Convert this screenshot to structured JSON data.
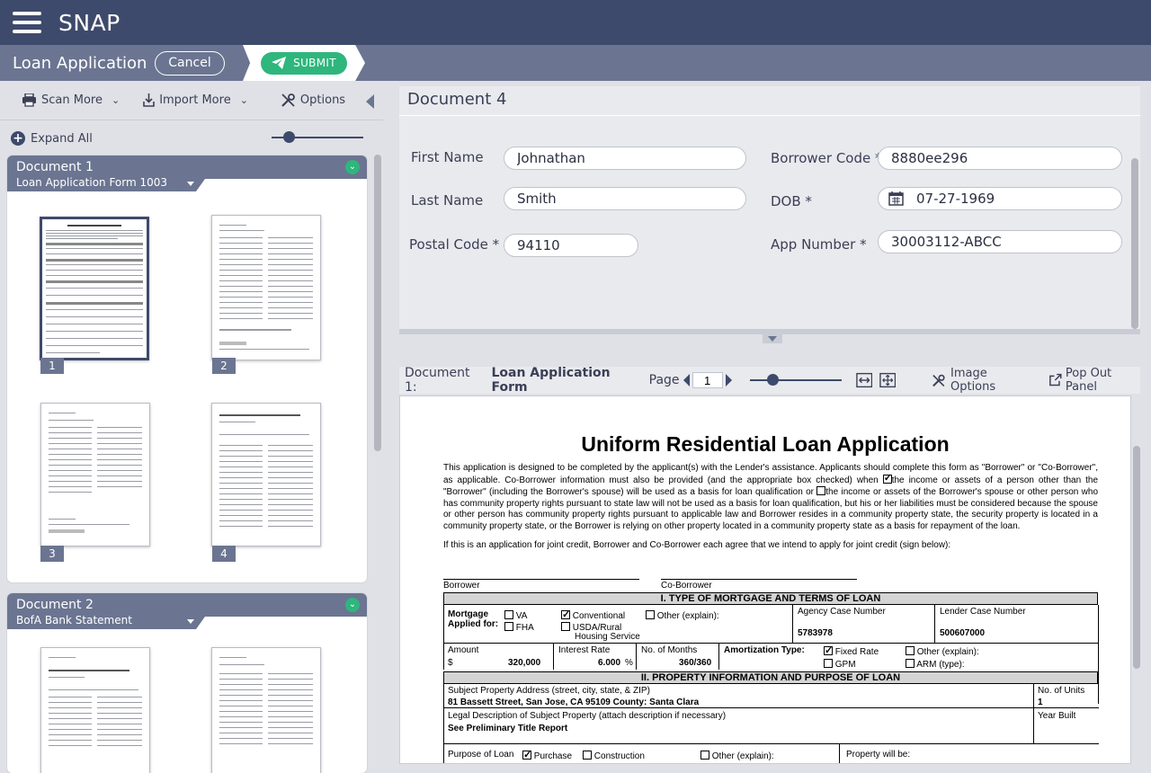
{
  "app": {
    "brand": "SNAP"
  },
  "subbar": {
    "title": "Loan Application",
    "cancel": "Cancel",
    "submit": "SUBMIT"
  },
  "left_toolbar": {
    "scan_more": "Scan More",
    "import_more": "Import More",
    "options": "Options",
    "expand_all": "Expand All"
  },
  "documents": [
    {
      "title": "Document 1",
      "subtitle": "Loan Application Form 1003",
      "pages": [
        "1",
        "2",
        "3",
        "4"
      ]
    },
    {
      "title": "Document 2",
      "subtitle": "BofA Bank Statement"
    }
  ],
  "form": {
    "title": "Document 4",
    "fields": {
      "first_name": {
        "label": "First Name",
        "value": "Johnathan"
      },
      "last_name": {
        "label": "Last Name",
        "value": "Smith"
      },
      "postal_code": {
        "label": "Postal Code *",
        "value": "94110"
      },
      "borrower_code": {
        "label": "Borrower Code *",
        "value": "8880ee296"
      },
      "dob": {
        "label": "DOB *",
        "value": "07-27-1969"
      },
      "app_number": {
        "label": "App Number *",
        "value": "30003112-ABCC"
      }
    }
  },
  "viewer": {
    "doc_label": "Document 1:",
    "doc_name": "Loan Application Form",
    "page_label": "Page",
    "page_value": "1",
    "image_options": "Image Options",
    "pop_out": "Pop Out Panel"
  },
  "pdf": {
    "title": "Uniform Residential Loan Application",
    "para1a": "This application is designed to be completed by the applicant(s) with the Lender's assistance. Applicants should complete this form as \"Borrower\" or \"Co-Borrower\", as applicable. Co-Borrower information must also be provided (and the appropriate box checked) when",
    "para1b": "the income or assets of a person other than the \"Borrower\" (including the Borrower's spouse) will be used as a basis for loan qualification or",
    "para1c": "the income or assets of the Borrower's spouse or other person who has community property rights pursuant to state law will not be used as a basis for loan qualification, but his or her liabilities must be considered because the spouse or other person has community property rights pursuant to applicable law and Borrower resides in a community property state, the security property is located in a community property state, or the Borrower is relying on other property located in a community property state as a basis for repayment of the loan.",
    "para2": "If this is an application for joint credit, Borrower and Co-Borrower each agree that we intend to apply for joint credit (sign below):",
    "borrower": "Borrower",
    "co_borrower": "Co-Borrower",
    "section1": "I. TYPE OF MORTGAGE AND TERMS OF LOAN",
    "mortgage_applied": "Mortgage",
    "applied_for": "Applied for:",
    "va": "VA",
    "fha": "FHA",
    "conventional": "Conventional",
    "usda": "USDA/Rural",
    "housing": "Housing Service",
    "other_explain": "Other (explain):",
    "agency_case_label": "Agency Case Number",
    "agency_case_value": "5783978",
    "lender_case_label": "Lender Case Number",
    "lender_case_value": "500607000",
    "amount_label": "Amount",
    "dollar": "$",
    "amount_value": "320,000",
    "interest_label": "Interest Rate",
    "interest_value": "6.000",
    "percent": "%",
    "months_label": "No. of Months",
    "months_value": "360/360",
    "amort_label": "Amortization Type:",
    "fixed": "Fixed Rate",
    "gpm": "GPM",
    "amort_other": "Other (explain):",
    "arm": "ARM (type):",
    "section2": "II. PROPERTY INFORMATION AND PURPOSE OF LOAN",
    "address_label": "Subject Property Address (street, city, state, & ZIP)",
    "address_value": "81 Bassett Street, San Jose, CA 95109   County: Santa Clara",
    "units_label": "No. of Units",
    "units_value": "1",
    "legal_label": "Legal Description of Subject Property (attach description if necessary)",
    "legal_value": "See Preliminary Title Report",
    "year_built": "Year Built",
    "purpose_label": "Purpose of Loan",
    "purchase": "Purchase",
    "construction": "Construction",
    "purpose_other": "Other (explain):",
    "property_will_be": "Property will be:"
  },
  "colors": {
    "topbar": "#3e4a6b",
    "subbar": "#6b7591",
    "accent_green": "#2eb67d"
  }
}
